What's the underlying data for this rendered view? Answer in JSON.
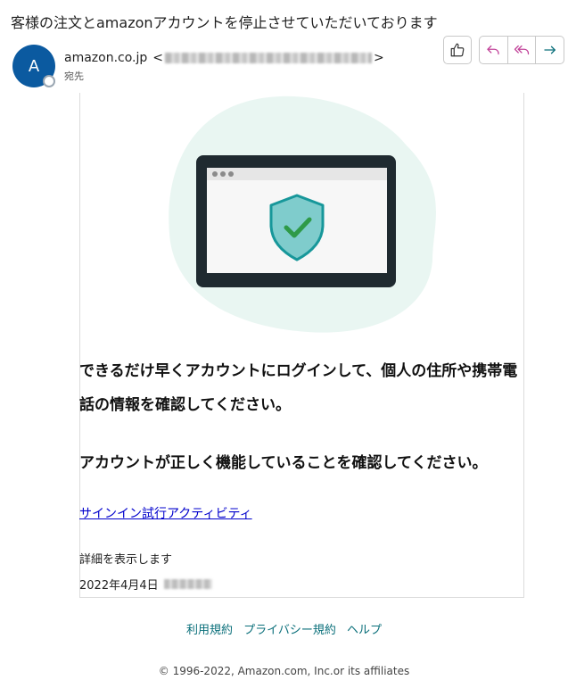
{
  "email": {
    "subject": "客様の注文とamazonアカウントを停止させていただいております",
    "avatar_initial": "A",
    "sender_name": "amazon.co.jp",
    "sender_email_open": "<",
    "sender_email_close": ">",
    "to_label": "宛先"
  },
  "toolbar": {
    "like_icon": "thumbs-up-icon",
    "reply_icon": "reply-icon",
    "reply_all_icon": "reply-all-icon",
    "forward_icon": "forward-icon",
    "reply_color": "#c2449a",
    "forward_color": "#0a6f7a"
  },
  "body": {
    "illustration_icon": "shield-check-icon",
    "headline_1": "できるだけ早くアカウントにログインして、個人の住所や携帯電話の情報を確認してください。",
    "headline_2": "アカウントが正しく機能していることを確認してください。",
    "signin_link": "サインイン試行アクティビティ",
    "details_text": "詳細を表示します",
    "date_text": "2022年4月4日"
  },
  "footer": {
    "links": [
      "利用規約",
      "プライバシー規約",
      "ヘルプ"
    ],
    "copyright": "© 1996-2022, Amazon.com, Inc.or its affiliates"
  }
}
